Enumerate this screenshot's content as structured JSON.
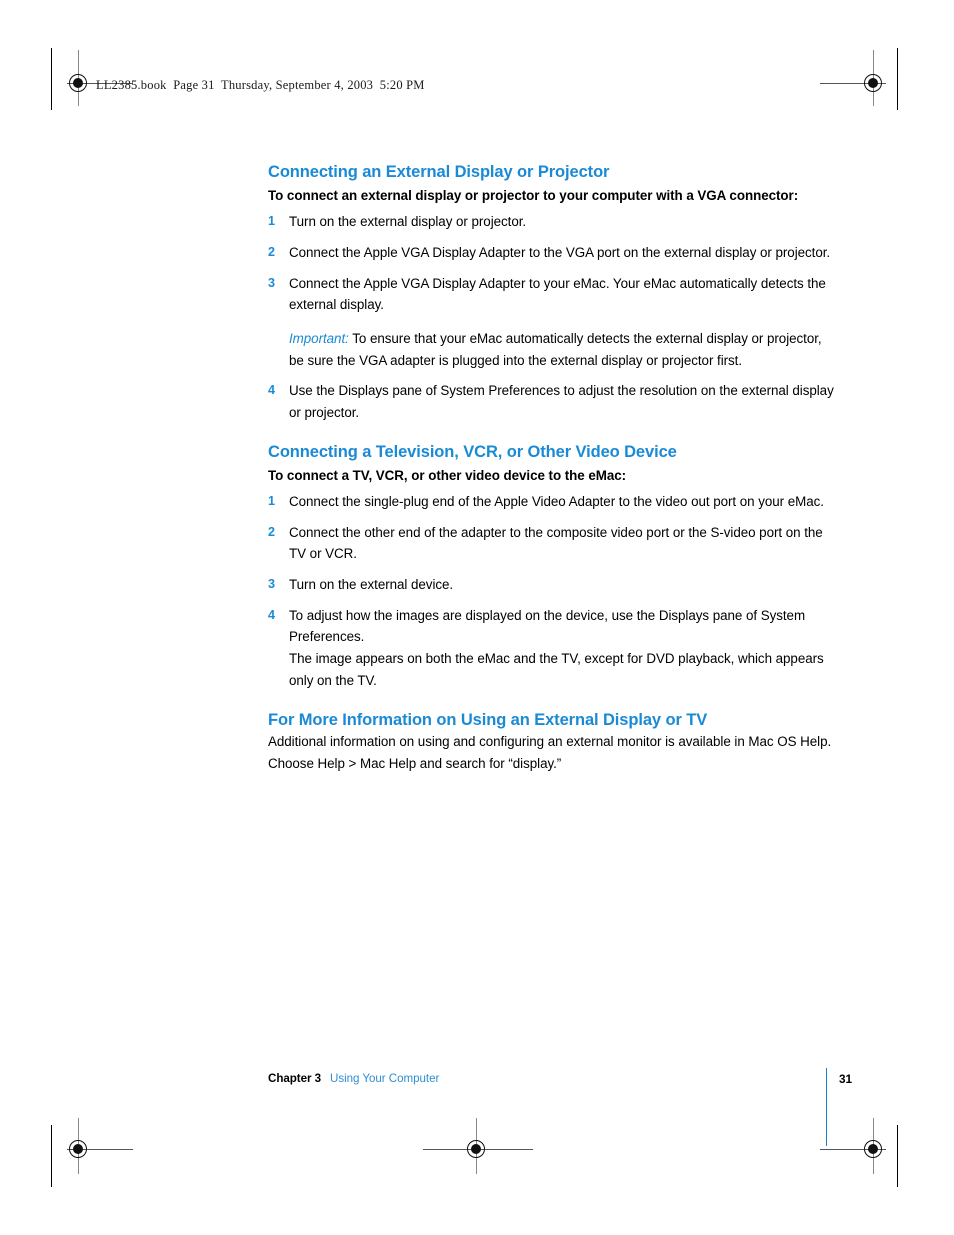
{
  "page": {
    "header_line": "LL2385.book  Page 31  Thursday, September 4, 2003  5:20 PM",
    "accent_blue": "#1b8ad5",
    "footer_rule_color": "#1b7fc4"
  },
  "sections": [
    {
      "heading": "Connecting an External Display or Projector",
      "lead": "To connect an external display or projector to your computer with a VGA connector:",
      "steps": [
        {
          "num": "1",
          "text": "Turn on the external display or projector."
        },
        {
          "num": "2",
          "text": "Connect the Apple VGA Display Adapter to the VGA port on the external display or projector."
        },
        {
          "num": "3",
          "text": "Connect the Apple VGA Display Adapter to your eMac. Your eMac automatically detects the external display."
        },
        {
          "num": "4",
          "text": "Use the Displays pane of System Preferences to adjust the resolution on the external display or projector."
        }
      ],
      "note": {
        "label": "Important:",
        "text": "To ensure that your eMac automatically detects the external display or projector, be sure the VGA adapter is plugged into the external display or projector first."
      }
    },
    {
      "heading": "Connecting a Television, VCR, or Other Video Device",
      "lead": "To connect a TV, VCR, or other video device to the eMac:",
      "steps": [
        {
          "num": "1",
          "text": "Connect the single-plug end of the Apple Video Adapter to the video out port on your eMac."
        },
        {
          "num": "2",
          "text": "Connect the other end of the adapter to the composite video port or the S-video port on the TV or VCR."
        },
        {
          "num": "3",
          "text": "Turn on the external device."
        },
        {
          "num": "4",
          "text": "To adjust how the images are displayed on the device, use the Displays pane of System Preferences."
        }
      ],
      "closing_para": "The image appears on both the eMac and the TV, except for DVD playback, which appears only on the TV."
    },
    {
      "heading": "For More Information on Using an External Display or TV",
      "body": "Additional information on using and configuring an external monitor is available in Mac OS Help. Choose Help > Mac Help and search for “display.”"
    }
  ],
  "footer": {
    "chapter_label": "Chapter 3",
    "chapter_title": "Using Your Computer",
    "page_number": "31"
  }
}
